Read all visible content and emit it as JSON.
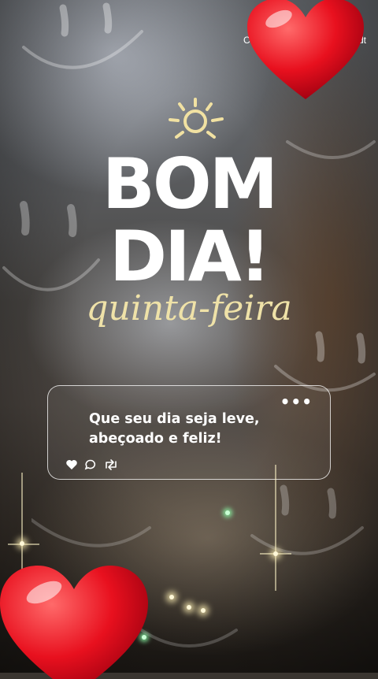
{
  "greeting": {
    "line1": "BOM",
    "line2": "DIA!",
    "weekday": "quinta-feira"
  },
  "post_card": {
    "message_line1": "Que seu dia seja leve,",
    "message_line2": "abeçoado e feliz!",
    "menu": "•••",
    "icons": [
      "heart-icon",
      "comment-icon",
      "repost-icon"
    ]
  },
  "top_corner": {
    "left_fragment": "C",
    "right_fragment": "dt"
  },
  "colors": {
    "title": "#ffffff",
    "weekday": "#efe2a8",
    "heart": "#e8101e"
  }
}
